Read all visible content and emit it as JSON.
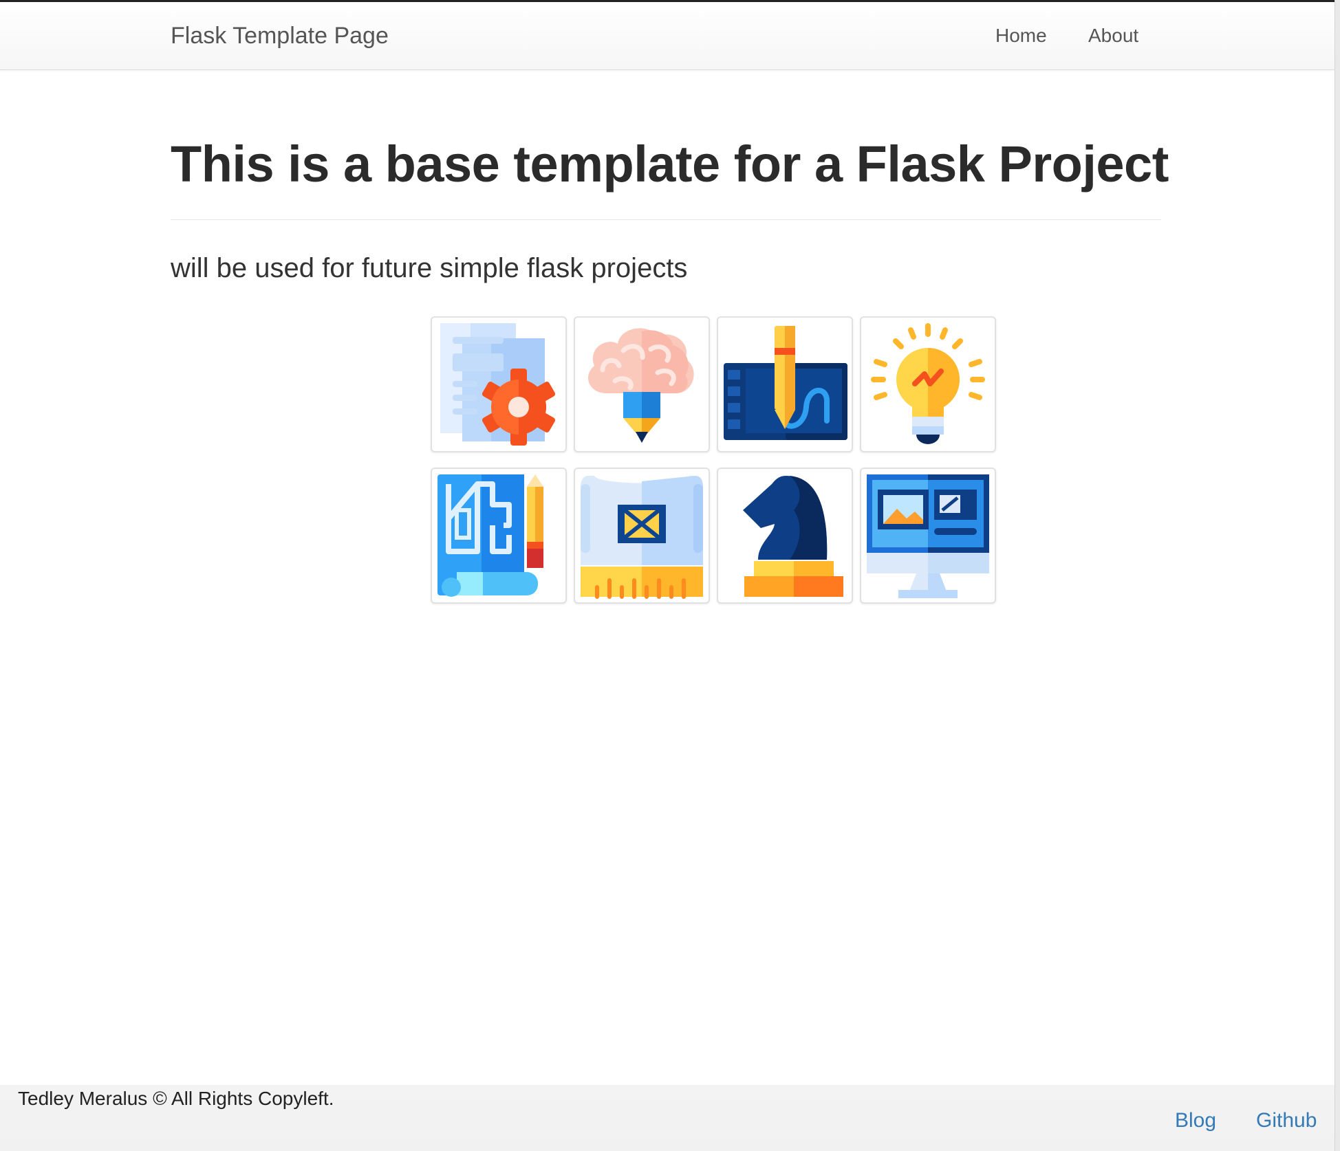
{
  "navbar": {
    "brand": "Flask Template Page",
    "links": [
      {
        "label": "Home"
      },
      {
        "label": "About"
      }
    ]
  },
  "main": {
    "title": "This is a base template for a Flask Project",
    "subtitle": "will be used for future simple flask projects"
  },
  "gallery": {
    "tiles": [
      {
        "icon": "document-gear-icon"
      },
      {
        "icon": "brain-pencil-icon"
      },
      {
        "icon": "drawing-tablet-icon"
      },
      {
        "icon": "lightbulb-icon"
      },
      {
        "icon": "blueprint-pencil-icon"
      },
      {
        "icon": "blueprint-ruler-icon"
      },
      {
        "icon": "chess-knight-icon"
      },
      {
        "icon": "monitor-design-icon"
      }
    ]
  },
  "footer": {
    "copyright": "Tedley Meralus © All Rights Copyleft.",
    "links": [
      {
        "label": "Blog"
      },
      {
        "label": "Github"
      }
    ]
  }
}
